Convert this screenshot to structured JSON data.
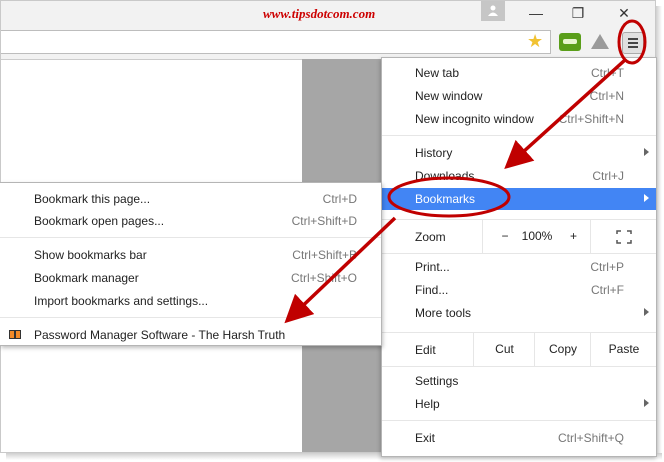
{
  "watermark": "www.tipsdotcom.com",
  "window": {
    "minimize": "—",
    "restore": "❐",
    "close": "✕"
  },
  "icons": {
    "star": "star-icon",
    "menu": "hamburger-menu-icon",
    "profile": "person-icon"
  },
  "menu": {
    "new_tab": {
      "label": "New tab",
      "shortcut": "Ctrl+T"
    },
    "new_window": {
      "label": "New window",
      "shortcut": "Ctrl+N"
    },
    "new_incognito": {
      "label": "New incognito window",
      "shortcut": "Ctrl+Shift+N"
    },
    "history": {
      "label": "History"
    },
    "downloads": {
      "label": "Downloads",
      "shortcut": "Ctrl+J"
    },
    "bookmarks": {
      "label": "Bookmarks"
    },
    "zoom": {
      "label": "Zoom",
      "minus": "−",
      "value": "100%",
      "plus": "+"
    },
    "print": {
      "label": "Print...",
      "shortcut": "Ctrl+P"
    },
    "find": {
      "label": "Find...",
      "shortcut": "Ctrl+F"
    },
    "more_tools": {
      "label": "More tools"
    },
    "edit": {
      "label": "Edit",
      "cut": "Cut",
      "copy": "Copy",
      "paste": "Paste"
    },
    "settings": {
      "label": "Settings"
    },
    "help": {
      "label": "Help"
    },
    "exit": {
      "label": "Exit",
      "shortcut": "Ctrl+Shift+Q"
    }
  },
  "bookmarks_submenu": {
    "bookmark_page": {
      "label": "Bookmark this page...",
      "shortcut": "Ctrl+D"
    },
    "bookmark_open_pages": {
      "label": "Bookmark open pages...",
      "shortcut": "Ctrl+Shift+D"
    },
    "show_bar": {
      "label": "Show bookmarks bar",
      "shortcut": "Ctrl+Shift+B"
    },
    "manager": {
      "label": "Bookmark manager",
      "shortcut": "Ctrl+Shift+O"
    },
    "import": {
      "label": "Import bookmarks and settings..."
    },
    "saved": [
      {
        "label": "Password Manager Software - The Harsh Truth"
      }
    ]
  },
  "colors": {
    "highlight": "#4285f4",
    "annotation": "#c00000"
  }
}
